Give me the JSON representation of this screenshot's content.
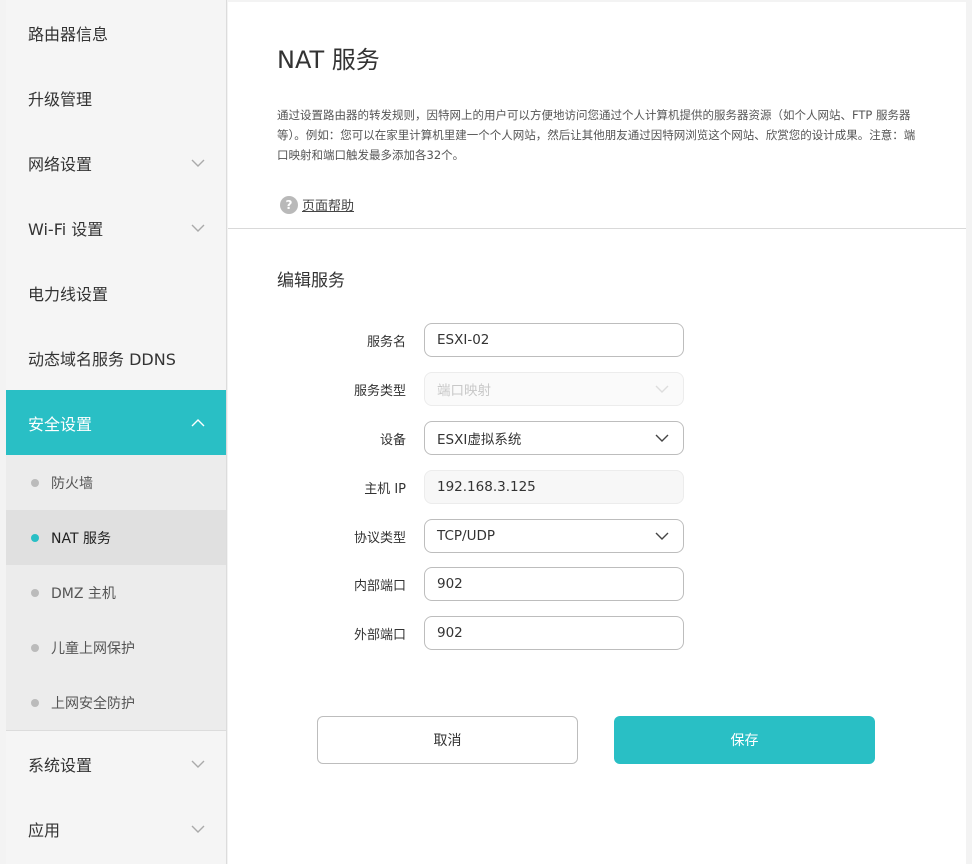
{
  "sidebar": {
    "items": [
      {
        "label": "路由器信息",
        "has_chevron": false
      },
      {
        "label": "升级管理",
        "has_chevron": false
      },
      {
        "label": "网络设置",
        "has_chevron": true
      },
      {
        "label": "Wi-Fi 设置",
        "has_chevron": true
      },
      {
        "label": "电力线设置",
        "has_chevron": false
      },
      {
        "label": "动态域名服务 DDNS",
        "has_chevron": false
      },
      {
        "label": "安全设置",
        "has_chevron": true,
        "expanded": true
      }
    ],
    "security_sub": [
      {
        "label": "防火墙"
      },
      {
        "label": "NAT 服务",
        "selected": true
      },
      {
        "label": "DMZ 主机"
      },
      {
        "label": "儿童上网保护"
      },
      {
        "label": "上网安全防护"
      }
    ],
    "bottom_items": [
      {
        "label": "系统设置"
      },
      {
        "label": "应用"
      }
    ]
  },
  "main": {
    "title": "NAT 服务",
    "description": "通过设置路由器的转发规则，因特网上的用户可以方便地访问您通过个人计算机提供的服务器资源（如个人网站、FTP 服务器等）。例如：您可以在家里计算机里建一个个人网站，然后让其他朋友通过因特网浏览这个网站、欣赏您的设计成果。注意：端口映射和端口触发最多添加各32个。",
    "help_label": "页面帮助",
    "section_title": "编辑服务",
    "form": {
      "service_name_label": "服务名",
      "service_name_value": "ESXI-02",
      "service_type_label": "服务类型",
      "service_type_value": "端口映射",
      "device_label": "设备",
      "device_value": "ESXI虚拟系统",
      "host_ip_label": "主机 IP",
      "host_ip_value": "192.168.3.125",
      "protocol_label": "协议类型",
      "protocol_value": "TCP/UDP",
      "internal_port_label": "内部端口",
      "internal_port_value": "902",
      "external_port_label": "外部端口",
      "external_port_value": "902"
    },
    "buttons": {
      "cancel": "取消",
      "save": "保存"
    }
  },
  "colors": {
    "accent": "#29bfc5"
  }
}
